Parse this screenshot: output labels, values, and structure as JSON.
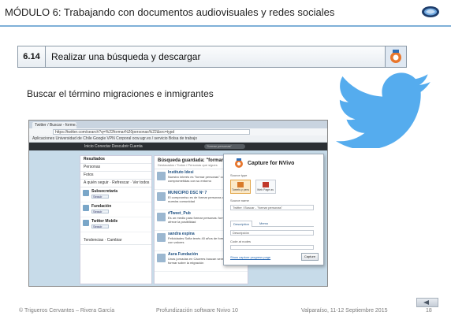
{
  "header": {
    "title": "MÓDULO 6: Trabajando con documentos audiovisuales y redes sociales",
    "icon": "nvivo-logo-icon"
  },
  "lesson": {
    "number": "6.14",
    "title": "Realizar una búsqueda y descargar",
    "icon": "ncapture-icon"
  },
  "subtitle": "Buscar el término migraciones e inmigrantes",
  "screenshot": {
    "tab_label": "Twitter / Buscar - forme...",
    "url": "https://twitter.com/search?q=%22formar%20personas%22&src=typd",
    "bookmarks": "Aplicaciones  Universidad de Chile  Google  VPN  Corporal  ocw.ugr.es / servicio  Bolsa de trabajo",
    "nav_items": "Inicio   Conectar   Descubrir   Cuenta",
    "nav_search": "\"formar personas\"",
    "left": {
      "results": "Resultados",
      "people": "Personas",
      "photos": "Fotos",
      "who_to_follow": "A quién seguir · Refrescar · Ver todos",
      "users": [
        {
          "name": "Subsecretaría",
          "follow": "Seguir"
        },
        {
          "name": "Fundación",
          "follow": "Seguir"
        },
        {
          "name": "Twitter Mobile",
          "follow": "Seguir"
        }
      ],
      "trends": "Tendencias · Cambiar"
    },
    "main": {
      "title": "Búsqueda guardada: \"formar personas\"",
      "subtitle": "Destacados / Todos / Personas que sigues",
      "tweets": [
        {
          "name": "Instituto Idesi",
          "text": "Nuestro interés es \"formar personas\" competentes y comprometidas con su entorno"
        },
        {
          "name": "MUNICIPIO DSC Nº 7",
          "text": "El compromiso es de formar personas de bien en nuestra comunidad"
        },
        {
          "name": "#Tweet_Pub",
          "text": "Es un medio para formar personas: formar personas ofrece la posibilidad"
        },
        {
          "name": "sandra espina",
          "text": "Felicidades Sofia tenés 40 años de formar personas con valores"
        },
        {
          "name": "Aura Fundación",
          "text": "Unas jornadas en Cáceres buscan sensibilizar y formar sobre la migración"
        }
      ]
    },
    "capture": {
      "title": "Capture for NVivo",
      "source_type_label": "Source type",
      "option1": "Tweets y personas",
      "option2": "Web Page as PDF",
      "source_name_label": "Source name",
      "source_name_value": "Twitter / Buscar - \"formar personas\"",
      "tab_description": "Description",
      "tab_memo": "Memo",
      "description_placeholder": "Descripción",
      "code_at_label": "Code at nodes",
      "link": "Show capture progress page",
      "capture_button": "Capture"
    }
  },
  "footer": {
    "author": "© Trigueros Cervantes – Rivera García",
    "course": "Profundización software Nvivo 10",
    "place": "Valparaíso, 11-12 Septiembre 2015",
    "page": "18",
    "back_icon": "back-arrow-icon"
  },
  "colors": {
    "header_rule": "#7fb0d8",
    "twitter_bird": "#55acee",
    "twitter_nav": "#2b2f33"
  }
}
